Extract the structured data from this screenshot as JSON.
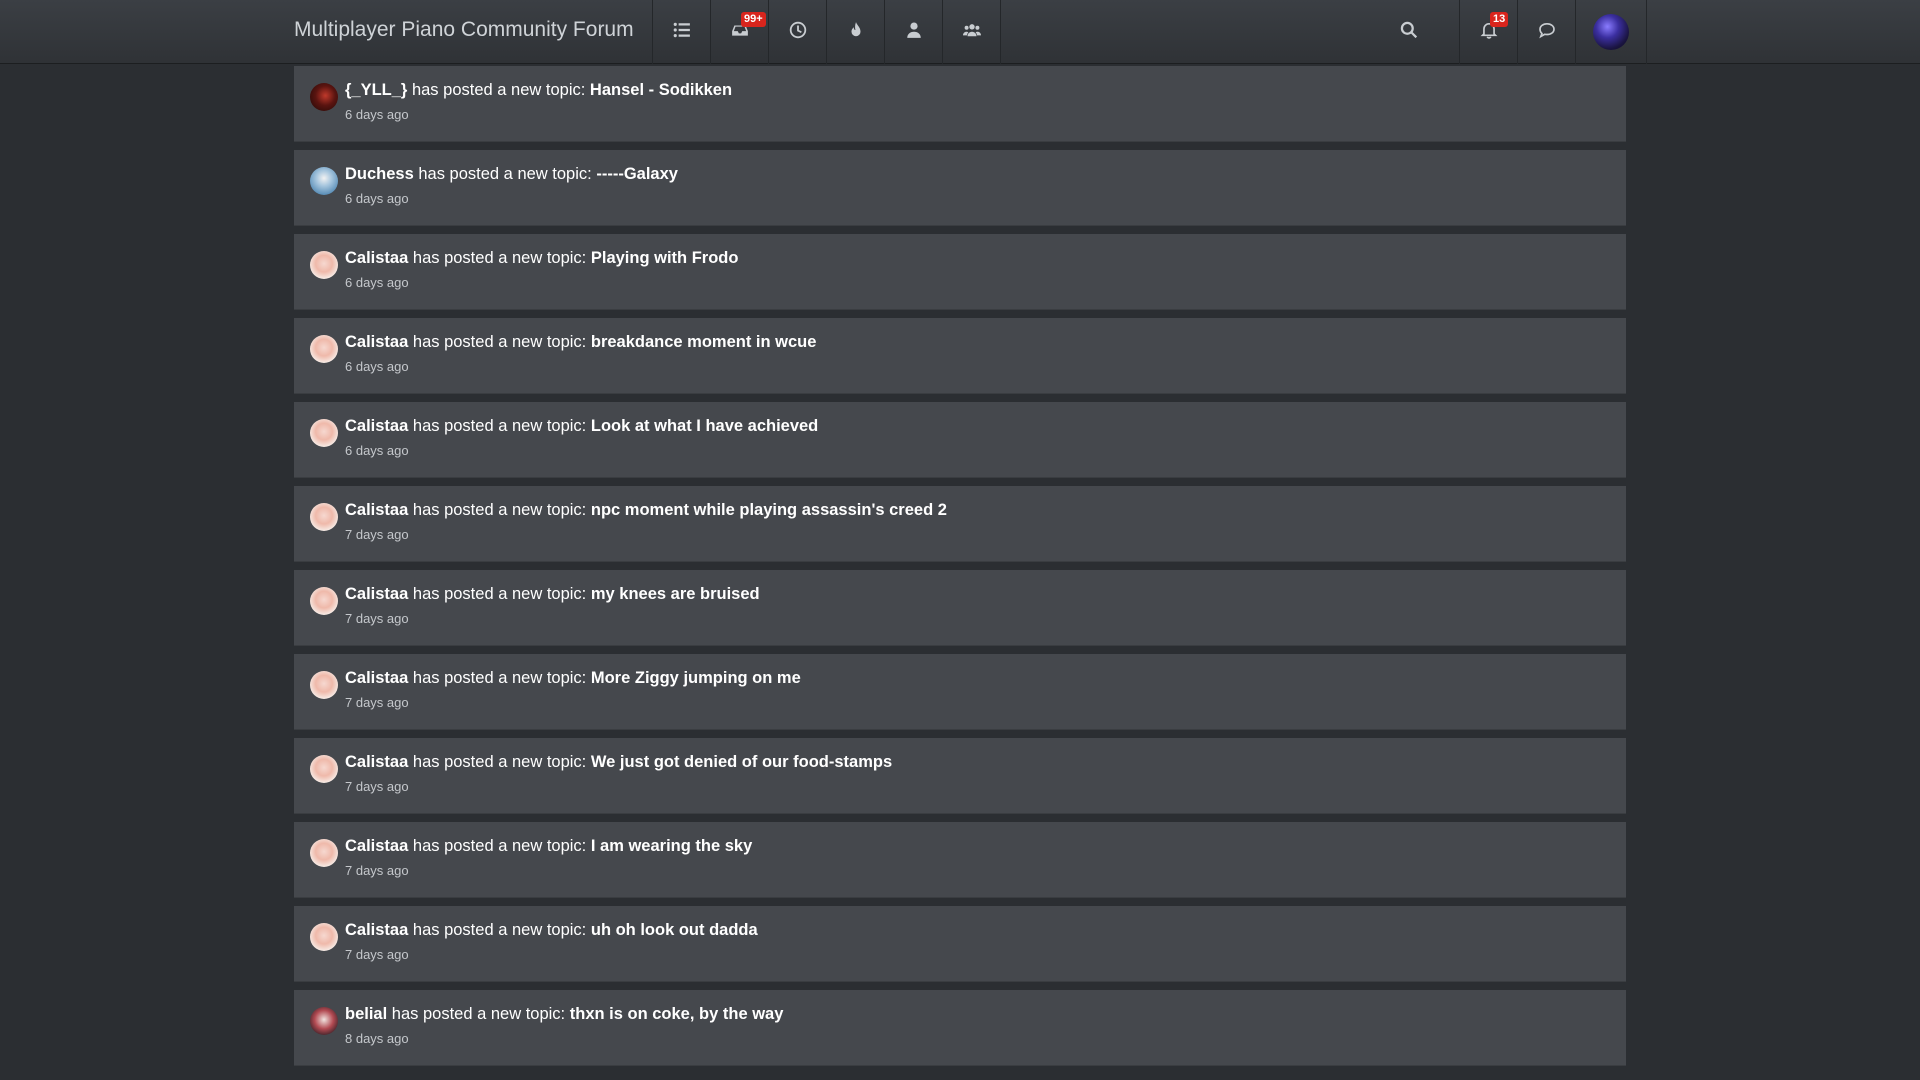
{
  "header": {
    "title": "Multiplayer Piano Community Forum",
    "unread_badge": "99+",
    "notifications_badge": "13",
    "icons": [
      "list-icon",
      "inbox-icon",
      "clock-icon",
      "fire-icon",
      "user-icon",
      "users-icon",
      "search-icon",
      "bell-icon",
      "chat-icon",
      "avatar"
    ]
  },
  "feed": {
    "verb": "has posted a new topic:",
    "items": [
      {
        "user": "{_YLL_}",
        "topic": "Hansel - Sodikken",
        "time": "6 days ago",
        "avatar": "yll"
      },
      {
        "user": "Duchess",
        "topic": "-----Galaxy",
        "time": "6 days ago",
        "avatar": "duchess"
      },
      {
        "user": "Calistaa",
        "topic": "Playing with Frodo",
        "time": "6 days ago",
        "avatar": "calistaa"
      },
      {
        "user": "Calistaa",
        "topic": "breakdance moment in wcue",
        "time": "6 days ago",
        "avatar": "calistaa"
      },
      {
        "user": "Calistaa",
        "topic": "Look at what I have achieved",
        "time": "6 days ago",
        "avatar": "calistaa"
      },
      {
        "user": "Calistaa",
        "topic": "npc moment while playing assassin's creed 2",
        "time": "7 days ago",
        "avatar": "calistaa"
      },
      {
        "user": "Calistaa",
        "topic": "my knees are bruised",
        "time": "7 days ago",
        "avatar": "calistaa"
      },
      {
        "user": "Calistaa",
        "topic": "More Ziggy jumping on me",
        "time": "7 days ago",
        "avatar": "calistaa"
      },
      {
        "user": "Calistaa",
        "topic": "We just got denied of our food-stamps",
        "time": "7 days ago",
        "avatar": "calistaa"
      },
      {
        "user": "Calistaa",
        "topic": "I am wearing the sky",
        "time": "7 days ago",
        "avatar": "calistaa"
      },
      {
        "user": "Calistaa",
        "topic": "uh oh look out dadda",
        "time": "7 days ago",
        "avatar": "calistaa"
      },
      {
        "user": "belial",
        "topic": "thxn is on coke, by the way",
        "time": "8 days ago",
        "avatar": "belial"
      }
    ]
  }
}
